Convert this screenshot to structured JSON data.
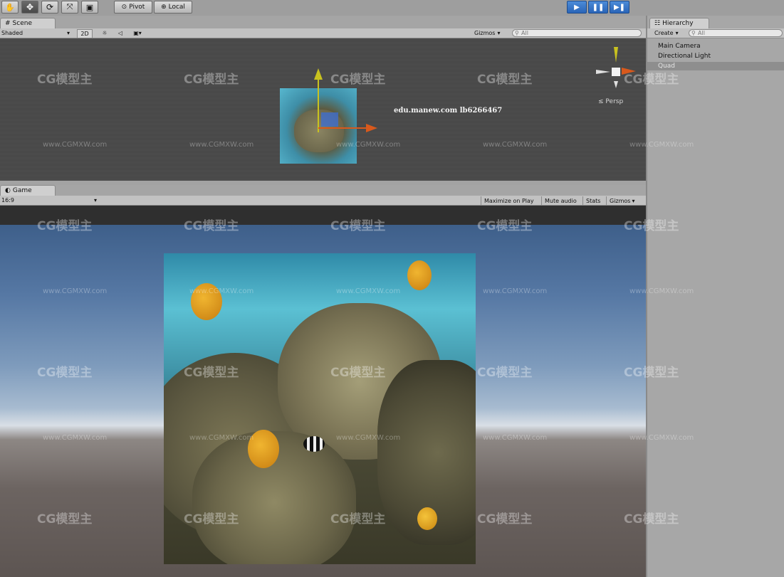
{
  "toolbar": {
    "tools": [
      "hand",
      "move",
      "rotate",
      "scale",
      "rect"
    ],
    "pivot_label": "Pivot",
    "local_label": "Local",
    "play_controls": [
      "play",
      "pause",
      "step"
    ]
  },
  "scene": {
    "tab_label": "Scene",
    "shading_mode": "Shaded",
    "mode_2d": "2D",
    "gizmos_label": "Gizmos",
    "search_placeholder": "All",
    "overlay_text": "edu.manew.com  lb6266467",
    "persp_label": "Persp",
    "axis_colors": {
      "x": "#d8591c",
      "y": "#c9c21f",
      "z": "#3b76d8"
    }
  },
  "game": {
    "tab_label": "Game",
    "aspect": "16:9",
    "maximize_label": "Maximize on Play",
    "mute_label": "Mute audio",
    "stats_label": "Stats",
    "gizmos_label": "Gizmos"
  },
  "hierarchy": {
    "tab_label": "Hierarchy",
    "create_label": "Create",
    "search_placeholder": "All",
    "items": [
      {
        "label": "Main Camera",
        "selected": false
      },
      {
        "label": "Directional Light",
        "selected": false
      },
      {
        "label": "Quad",
        "selected": true
      }
    ]
  },
  "watermark": {
    "logo": "CG模型主",
    "url": "www.CGMXW.com"
  }
}
